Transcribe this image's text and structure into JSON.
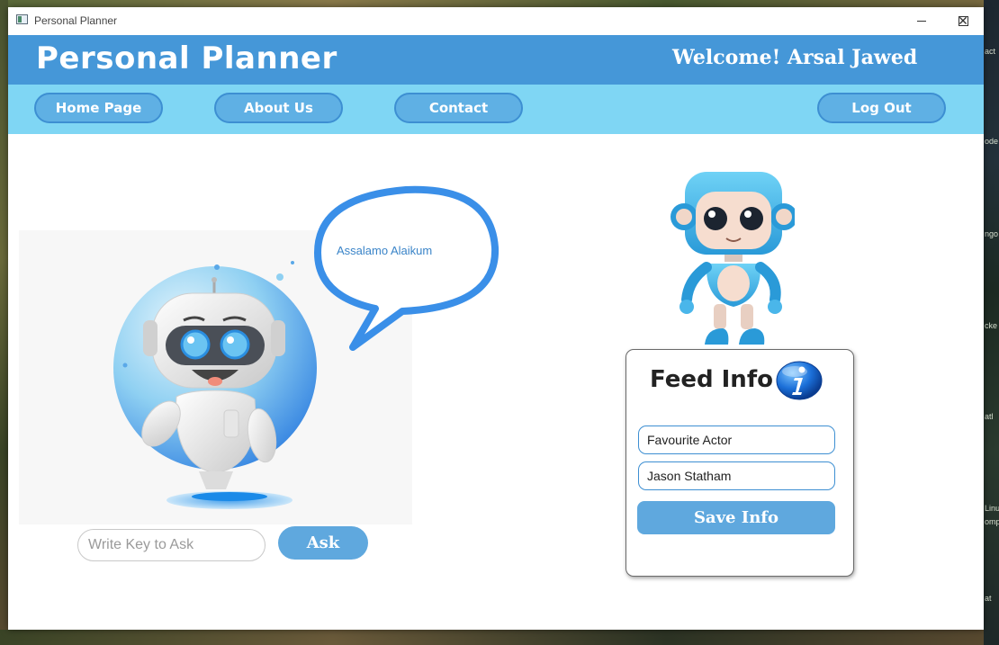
{
  "window": {
    "title": "Personal Planner",
    "icon": "app-icon",
    "controls": {
      "minimize": "minimize-icon",
      "maximize": "maximize-icon",
      "close": "close-icon",
      "close_glyph": "✕"
    }
  },
  "header": {
    "brand": "Personal Planner",
    "welcome": "Welcome! Arsal Jawed",
    "background": "#4597d8"
  },
  "nav": {
    "background": "#7fd6f4",
    "items": [
      {
        "label": "Home Page"
      },
      {
        "label": "About Us"
      },
      {
        "label": "Contact"
      }
    ],
    "logout": "Log Out"
  },
  "assistant": {
    "bubble_text": "Assalamo Alaikum",
    "input": {
      "placeholder": "Write Key to Ask",
      "value": ""
    },
    "ask_label": "Ask"
  },
  "feed": {
    "title": "Feed Info",
    "icon": "info-icon",
    "fields": [
      {
        "value": "Favourite Actor"
      },
      {
        "value": "Jason Statham"
      }
    ],
    "save_label": "Save Info"
  },
  "desktop": {
    "edge_labels": [
      "act",
      "ode",
      "ngo",
      "cke",
      "atl",
      "Linu",
      "omp",
      "at"
    ]
  }
}
